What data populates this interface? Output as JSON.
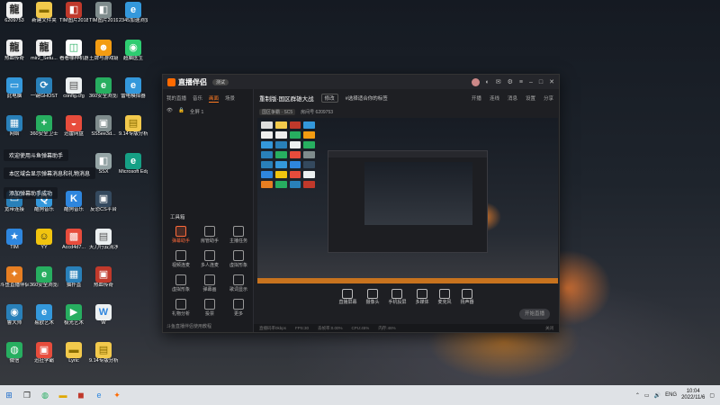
{
  "desktop": {
    "icons": [
      {
        "label": "6209753",
        "glyph": "龍",
        "color": "#eeeeee",
        "fg": "#222"
      },
      {
        "label": "新建文件夹",
        "glyph": "▬",
        "color": "#f2c94c",
        "fg": "#8a6d00"
      },
      {
        "label": "TIM图片20181008...",
        "glyph": "◧",
        "color": "#c0392b",
        "fg": "#fff"
      },
      {
        "label": "TIM图片20191027...",
        "glyph": "◧",
        "color": "#7f8c8d",
        "fg": "#fff"
      },
      {
        "label": "2345加速浏览器",
        "glyph": "e",
        "color": "#3498db",
        "fg": "#fff"
      },
      {
        "label": "热血传奇",
        "glyph": "龍",
        "color": "#eeeeee",
        "fg": "#222"
      },
      {
        "label": "mir2_Setu...",
        "glyph": "龍",
        "color": "#eeeeee",
        "fg": "#222"
      },
      {
        "label": "看看哪种机器人就是hmisa...",
        "glyph": "◫",
        "color": "#ffffff",
        "fg": "#27ae60"
      },
      {
        "label": "王牌与游戏链接",
        "glyph": "☻",
        "color": "#f39c12",
        "fg": "#fff"
      },
      {
        "label": "超脑医生",
        "glyph": "◉",
        "color": "#2ecc71",
        "fg": "#fff"
      },
      {
        "label": "此电脑",
        "glyph": "▭",
        "color": "#3498db",
        "fg": "#fff"
      },
      {
        "label": "一键GHOST",
        "glyph": "⟳",
        "color": "#2980b9",
        "fg": "#fff"
      },
      {
        "label": "config.cfg",
        "glyph": "▤",
        "color": "#ecf0f1",
        "fg": "#555"
      },
      {
        "label": "360安全浏览器",
        "glyph": "e",
        "color": "#27ae60",
        "fg": "#fff"
      },
      {
        "label": "雷电模拟器",
        "glyph": "e",
        "color": "#3498db",
        "fg": "#fff"
      },
      {
        "label": "网络",
        "glyph": "▦",
        "color": "#2980b9",
        "fg": "#fff"
      },
      {
        "label": "360安全卫士",
        "glyph": "+",
        "color": "#27ae60",
        "fg": "#fff"
      },
      {
        "label": "迅雷网盘",
        "glyph": "◒",
        "color": "#e74c3c",
        "fg": "#fff"
      },
      {
        "label": "SS5ee3d...",
        "glyph": "▣",
        "color": "#7f8c8d",
        "fg": "#fff"
      },
      {
        "label": "9.14专版分析资料",
        "glyph": "▤",
        "color": "#f2c94c",
        "fg": "#8a6d00"
      },
      {
        "label": "SSX",
        "glyph": "◧",
        "color": "#95a5a6",
        "fg": "#fff"
      },
      {
        "label": "Microsoft Edge",
        "glyph": "e",
        "color": "#16a085",
        "fg": "#fff"
      },
      {
        "label": "宽带连接",
        "glyph": "▭",
        "color": "#2980b9",
        "fg": "#fff"
      },
      {
        "label": "酷狗音乐",
        "glyph": "Q",
        "color": "#3498db",
        "fg": "#fff"
      },
      {
        "label": "酷狗音乐",
        "glyph": "K",
        "color": "#2e86de",
        "fg": "#fff"
      },
      {
        "label": "反恐CS平台",
        "glyph": "▣",
        "color": "#34495e",
        "fg": "#fff"
      },
      {
        "label": "TIM",
        "glyph": "★",
        "color": "#2e86de",
        "fg": "#fff"
      },
      {
        "label": "YY",
        "glyph": "☺",
        "color": "#f1c40f",
        "fg": "#222"
      },
      {
        "label": "Accd4d7...",
        "glyph": "▩",
        "color": "#e74c3c",
        "fg": "#fff"
      },
      {
        "label": "天刀行云流水训练",
        "glyph": "▤",
        "color": "#ecf0f1",
        "fg": "#555"
      },
      {
        "label": "斗鱼直播伴侣",
        "glyph": "✦",
        "color": "#e67e22",
        "fg": "#fff"
      },
      {
        "label": "360安全浏览器",
        "glyph": "e",
        "color": "#27ae60",
        "fg": "#fff"
      },
      {
        "label": "猫扑直",
        "glyph": "▦",
        "color": "#2980b9",
        "fg": "#fff"
      },
      {
        "label": "热血传奇",
        "glyph": "▣",
        "color": "#c0392b",
        "fg": "#fff"
      },
      {
        "label": "鲁大师",
        "glyph": "◉",
        "color": "#2980b9",
        "fg": "#fff"
      },
      {
        "label": "易欧艺术",
        "glyph": "e",
        "color": "#3498db",
        "fg": "#fff"
      },
      {
        "label": "极光艺术",
        "glyph": "▶",
        "color": "#27ae60",
        "fg": "#fff"
      },
      {
        "label": "W",
        "glyph": "W",
        "color": "#ecf0f1",
        "fg": "#2e86de"
      },
      {
        "label": "微信",
        "glyph": "◍",
        "color": "#27ae60",
        "fg": "#fff"
      },
      {
        "label": "迅狂学霸",
        "glyph": "▣",
        "color": "#e74c3c",
        "fg": "#fff"
      },
      {
        "label": "Lyric",
        "glyph": "▬",
        "color": "#f2c94c",
        "fg": "#8a6d00"
      },
      {
        "label": "9.14专版分析资料",
        "glyph": "▤",
        "color": "#f2c94c",
        "fg": "#8a6d00"
      }
    ],
    "notifications": [
      "欢迎使用斗鱼弹幕助手",
      "本区域会显示弹幕消息和礼物消息",
      "添加弹幕助手成功"
    ]
  },
  "app": {
    "name": "直播伴侣",
    "badge": "测试",
    "left_tabs": [
      "我的直播",
      "音乐",
      "画面",
      "场景"
    ],
    "active_left_tab": "画面",
    "scene_label": "全屏 1",
    "tools_title": "工具箱",
    "tools": [
      {
        "label": "弹幕助手",
        "accent": true
      },
      {
        "label": "房管助手",
        "accent": false
      },
      {
        "label": "主播任务",
        "accent": false
      },
      {
        "label": "视频连麦",
        "accent": false
      },
      {
        "label": "多人连麦",
        "accent": false
      },
      {
        "label": "虚拟形象",
        "accent": false
      },
      {
        "label": "虚拟形象",
        "accent": false
      },
      {
        "label": "弹幕画",
        "accent": false
      },
      {
        "label": "歌词显示",
        "accent": false
      },
      {
        "label": "礼物分析",
        "accent": false
      },
      {
        "label": "投票",
        "accent": false
      },
      {
        "label": "更多",
        "accent": false
      }
    ],
    "left_footer": "斗鱼直播伴侣使用教程",
    "room_title": "重制版·国区群雄大战",
    "room_tag": "修改",
    "room_category": "#选择适合你的标签",
    "room_meta": [
      "国区争霸 · SC5",
      "房间号 6209753"
    ],
    "header_actions": [
      "开播",
      "连线",
      "消息",
      "设置",
      "分享"
    ],
    "controls": [
      {
        "label": "直播屏幕"
      },
      {
        "label": "摄像头"
      },
      {
        "label": "手机投屏"
      },
      {
        "label": "多媒体"
      },
      {
        "label": "麦克风"
      },
      {
        "label": "扬声器"
      }
    ],
    "go_live": "开始直播",
    "status_bar": [
      "直播码率0kbps",
      "FPS:30",
      "丢帧率:0.00%",
      "CPU:45%",
      "内存:46%"
    ],
    "status_right": "关闭"
  },
  "taskbar": {
    "tray_lang": "ENG",
    "time": "10:04",
    "date": "2022/11/6"
  }
}
